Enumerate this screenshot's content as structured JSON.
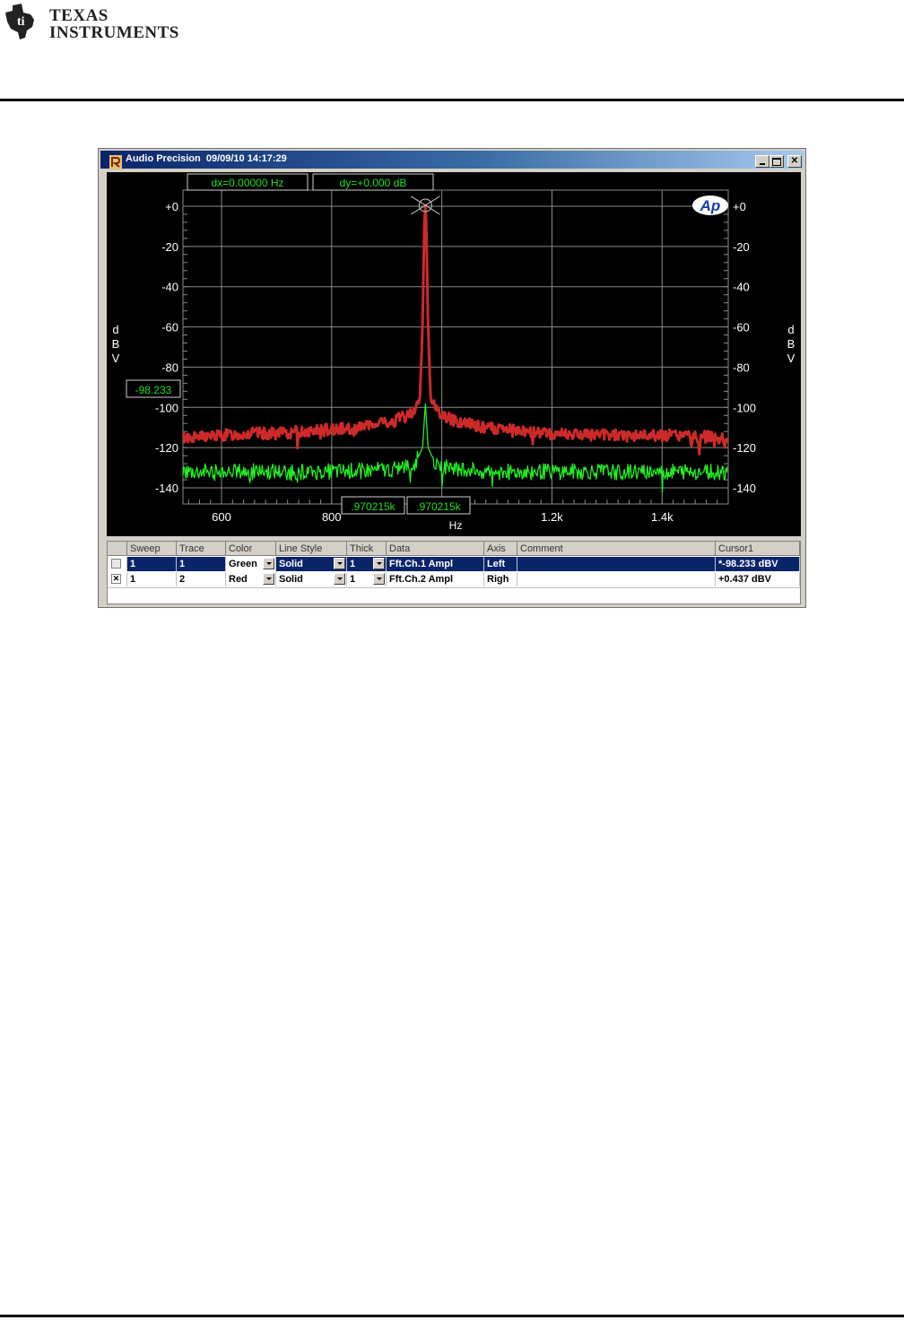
{
  "document": {
    "logo_line1": "Texas",
    "logo_line2": "Instruments"
  },
  "window": {
    "title": "Audio Precision  09/09/10 14:17:29",
    "buttons": [
      "minimize",
      "maximize",
      "close"
    ]
  },
  "plot": {
    "cursor_dx": "dx=0.00000  Hz",
    "cursor_dy": "dy=+0.000  dB",
    "cursor_y_readout": "-98.233",
    "cursor_x_readout_1": ".970215k",
    "cursor_x_readout_2": ".970215k",
    "x_axis_label": "Hz",
    "y_axis_label_left": [
      "d",
      "B",
      "V"
    ],
    "y_axis_label_right": [
      "d",
      "B",
      "V"
    ],
    "brand_mark": "Ap",
    "colors": {
      "background": "#000000",
      "grid": "#8a8a8a",
      "green": "#22ee22",
      "red": "#cc2a2a",
      "readout": "#22dd22"
    }
  },
  "chart_data": {
    "type": "line",
    "xlabel": "Hz",
    "ylabel": "dBV",
    "x_ticks": [
      "600",
      "800",
      "1.2k",
      "1.4k"
    ],
    "x_tick_values": [
      600,
      800,
      1200,
      1400
    ],
    "xlim": [
      530,
      1520
    ],
    "y_ticks": [
      "+0",
      "-20",
      "-40",
      "-60",
      "-80",
      "-100",
      "-120",
      "-140"
    ],
    "y_tick_values": [
      0,
      -20,
      -40,
      -60,
      -80,
      -100,
      -120,
      -140
    ],
    "ylim": [
      -148,
      8
    ],
    "grid": true,
    "series": [
      {
        "color": "#cc2a2a",
        "axis": "Right",
        "noise_floor": -113,
        "peak_x": 970.215,
        "peak_y": 0.437,
        "points": [
          [
            530,
            -115
          ],
          [
            600,
            -114
          ],
          [
            650,
            -113
          ],
          [
            700,
            -113
          ],
          [
            750,
            -112
          ],
          [
            800,
            -111
          ],
          [
            850,
            -110
          ],
          [
            900,
            -108
          ],
          [
            940,
            -104
          ],
          [
            960,
            -97
          ],
          [
            965,
            -60
          ],
          [
            968,
            -10
          ],
          [
            970.215,
            0.437
          ],
          [
            972,
            -10
          ],
          [
            975,
            -60
          ],
          [
            980,
            -97
          ],
          [
            1000,
            -104
          ],
          [
            1040,
            -108
          ],
          [
            1100,
            -111
          ],
          [
            1200,
            -113
          ],
          [
            1300,
            -114
          ],
          [
            1400,
            -114
          ],
          [
            1520,
            -115
          ]
        ]
      },
      {
        "color": "#22ee22",
        "axis": "Left",
        "noise_floor": -132,
        "peak_x": 970.215,
        "peak_y": -98.233,
        "points": [
          [
            530,
            -132
          ],
          [
            600,
            -132
          ],
          [
            700,
            -132
          ],
          [
            800,
            -132
          ],
          [
            900,
            -131
          ],
          [
            950,
            -129
          ],
          [
            965,
            -120
          ],
          [
            970.215,
            -98.233
          ],
          [
            975,
            -120
          ],
          [
            990,
            -129
          ],
          [
            1100,
            -132
          ],
          [
            1200,
            -132
          ],
          [
            1300,
            -132
          ],
          [
            1400,
            -132
          ],
          [
            1520,
            -132
          ]
        ]
      }
    ]
  },
  "table": {
    "headers": [
      "Sweep",
      "Trace",
      "Color",
      "Line Style",
      "Thick",
      "Data",
      "Axis",
      "Comment",
      "Cursor1"
    ],
    "rows": [
      {
        "checked": "",
        "sweep": "1",
        "trace": "1",
        "color": "Green",
        "line_style": "Solid",
        "thick": "1",
        "data": "Fft.Ch.1 Ampl",
        "axis": "Left",
        "comment": "",
        "cursor1": "*-98.233  dBV"
      },
      {
        "checked": "✕",
        "sweep": "1",
        "trace": "2",
        "color": "Red",
        "line_style": "Solid",
        "thick": "1",
        "data": "Fft.Ch.2 Ampl",
        "axis": "Righ",
        "comment": "",
        "cursor1": "+0.437   dBV"
      }
    ]
  }
}
